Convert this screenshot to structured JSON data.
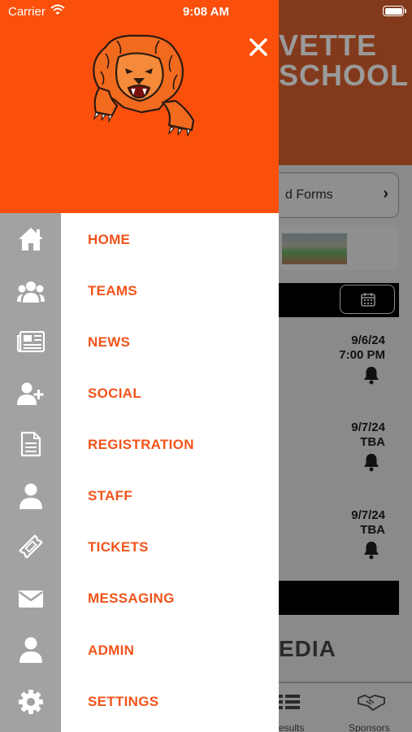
{
  "status_bar": {
    "carrier": "Carrier",
    "time": "9:08 AM"
  },
  "background": {
    "title_line1": "VETTE",
    "title_line2": "SCHOOL",
    "forms_label": "d Forms",
    "games": [
      {
        "date": "9/6/24",
        "time": "7:00 PM"
      },
      {
        "date": "9/7/24",
        "time": "TBA"
      },
      {
        "date": "9/7/24",
        "time": "TBA"
      }
    ],
    "media_label": "EDIA",
    "tabs": [
      {
        "label": "esults",
        "icon": "results-icon"
      },
      {
        "label": "Sponsors",
        "icon": "handshake-icon"
      }
    ]
  },
  "drawer": {
    "colors": {
      "accent": "#fb500b",
      "menu_text": "#f1541b",
      "rail": "#a2a2a2"
    },
    "menu": [
      {
        "label": "HOME",
        "icon": "home-icon"
      },
      {
        "label": "TEAMS",
        "icon": "group-icon"
      },
      {
        "label": "NEWS",
        "icon": "newspaper-icon"
      },
      {
        "label": "SOCIAL",
        "icon": "user-plus-icon"
      },
      {
        "label": "REGISTRATION",
        "icon": "document-icon"
      },
      {
        "label": "STAFF",
        "icon": "user-icon"
      },
      {
        "label": "TICKETS",
        "icon": "ticket-icon"
      },
      {
        "label": "MESSAGING",
        "icon": "envelope-icon"
      },
      {
        "label": "ADMIN",
        "icon": "user-icon"
      },
      {
        "label": "SETTINGS",
        "icon": "gear-icon"
      }
    ]
  }
}
